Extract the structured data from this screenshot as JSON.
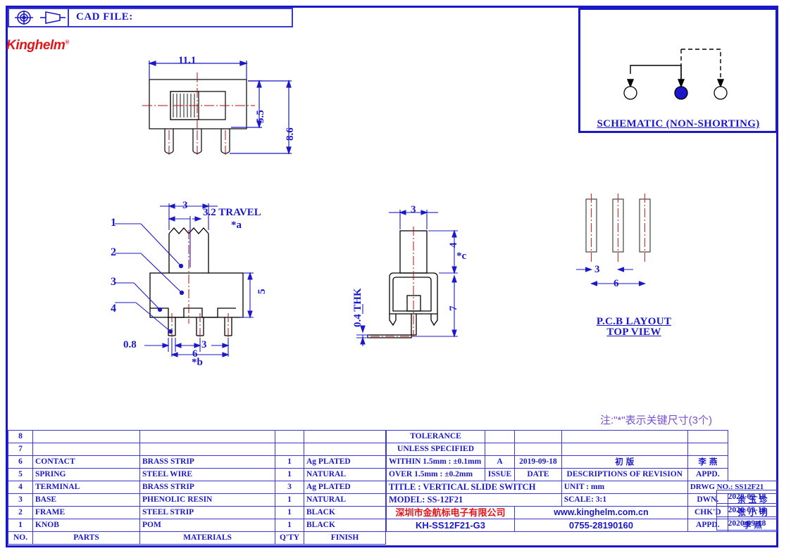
{
  "header": {
    "projection_icon": "first-angle-projection-icon",
    "cone_icon": "projection-cone-icon",
    "cad_file_label": "CAD FILE:",
    "cad_file_value": "",
    "logo_text": "Kinghelm",
    "logo_mark": "®"
  },
  "schematic": {
    "caption": "SCHEMATIC (NON-SHORTING)",
    "terminals": [
      "open",
      "filled",
      "open"
    ],
    "active_color": "#1a18c8"
  },
  "views": {
    "top_view": {
      "dim_width": "11.1",
      "dim_body_height": "5.5",
      "dim_overall_height": "8.6"
    },
    "front_view": {
      "dim_knob_width": "3",
      "dim_travel": "3.2  TRAVEL",
      "key_a": "*a",
      "dim_body_height": "5",
      "dim_terminal_width": "0.8",
      "dim_pitch": "3",
      "dim_span": "6",
      "key_b": "*b",
      "part_labels": [
        "1",
        "2",
        "3",
        "4"
      ]
    },
    "side_view": {
      "dim_knob_width": "3",
      "dim_knob_height": "4",
      "key_c": "*c",
      "dim_body_height": "7",
      "dim_thickness": "0.4 THK"
    },
    "pcb_layout": {
      "dim_pitch": "3",
      "dim_span": "6",
      "caption_line1": "P.C.B  LAYOUT",
      "caption_line2": "TOP  VIEW"
    }
  },
  "note": "注:\"*\"表示关键尺寸(3个)",
  "parts_table": {
    "columns": [
      "NO.",
      "PARTS",
      "MATERIALS",
      "Q'TY",
      "FINISH"
    ],
    "rows": [
      {
        "no": "8",
        "parts": "",
        "materials": "",
        "qty": "",
        "finish": ""
      },
      {
        "no": "7",
        "parts": "",
        "materials": "",
        "qty": "",
        "finish": ""
      },
      {
        "no": "6",
        "parts": "CONTACT",
        "materials": "BRASS  STRIP",
        "qty": "1",
        "finish": "Ag  PLATED"
      },
      {
        "no": "5",
        "parts": "SPRING",
        "materials": "STEEL  WIRE",
        "qty": "1",
        "finish": "NATURAL"
      },
      {
        "no": "4",
        "parts": "TERMINAL",
        "materials": "BRASS  STRIP",
        "qty": "3",
        "finish": "Ag  PLATED"
      },
      {
        "no": "3",
        "parts": "BASE",
        "materials": "PHENOLIC  RESIN",
        "qty": "1",
        "finish": "NATURAL"
      },
      {
        "no": "2",
        "parts": "FRAME",
        "materials": "STEEL  STRIP",
        "qty": "1",
        "finish": "BLACK"
      },
      {
        "no": "1",
        "parts": "KNOB",
        "materials": "POM",
        "qty": "1",
        "finish": "BLACK"
      }
    ]
  },
  "title_block": {
    "tolerance_title_l1": "TOLERANCE",
    "tolerance_title_l2": "UNLESS   SPECIFIED",
    "tolerance_within": "WITHIN 1.5mm : ±0.1mm",
    "tolerance_over": "OVER 1.5mm : ±0.2mm",
    "issue_value": "A",
    "issue_label": "ISSUE",
    "date_value": "2019-09-18",
    "date_label": "DATE",
    "revision_value": "初  版",
    "revision_label": "DESCRIPTIONS  OF  REVISION",
    "appd_rev_value": "李  燕",
    "appd_rev_label": "APPD.",
    "title_label": "TITLE :    VERTICAL  SLIDE  SWITCH",
    "model_label": "MODEL:   SS-12F21",
    "unit_label": "UNIT :    mm",
    "scale_label": "SCALE:   3:1",
    "drwg_no_label": "DRWG NO.: SS12F21",
    "dwn_label": "DWN.",
    "dwn_name": "余 玉 珍",
    "dwn_date": "2020-09-18",
    "chkd_label": "CHK'D",
    "chkd_name": "张 小 明",
    "chkd_date": "2020-09-18",
    "appd_label": "APPD.",
    "appd_name": "李   燕",
    "appd_date": "2020-09-18",
    "company_cn": "深圳市金航标电子有限公司",
    "website": "www.kinghelm.com.cn",
    "part_number": "KH-SS12F21-G3",
    "phone": "0755-28190160"
  }
}
